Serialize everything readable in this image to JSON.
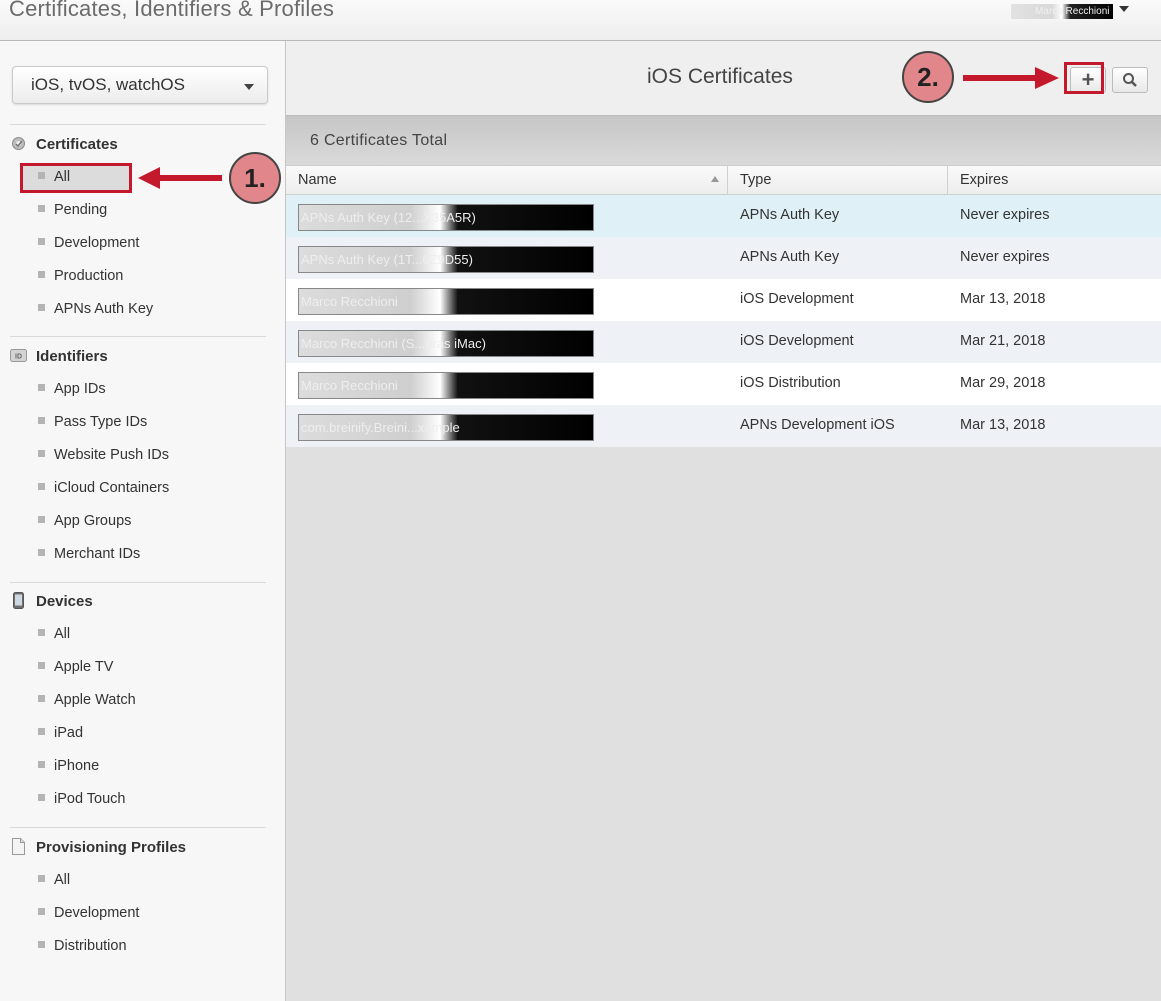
{
  "header": {
    "title": "Certificates, Identifiers & Profiles",
    "account_name": "Marco Recchioni"
  },
  "sidebar": {
    "platform_select": "iOS, tvOS, watchOS",
    "sections": [
      {
        "title": "Certificates",
        "icon": "certificate-gear-icon",
        "items": [
          "All",
          "Pending",
          "Development",
          "Production",
          "APNs Auth Key"
        ],
        "selected": "All"
      },
      {
        "title": "Identifiers",
        "icon": "id-badge-icon",
        "items": [
          "App IDs",
          "Pass Type IDs",
          "Website Push IDs",
          "iCloud Containers",
          "App Groups",
          "Merchant IDs"
        ]
      },
      {
        "title": "Devices",
        "icon": "iphone-device-icon",
        "items": [
          "All",
          "Apple TV",
          "Apple Watch",
          "iPad",
          "iPhone",
          "iPod Touch"
        ]
      },
      {
        "title": "Provisioning Profiles",
        "icon": "document-icon",
        "items": [
          "All",
          "Development",
          "Distribution"
        ]
      }
    ]
  },
  "main": {
    "title": "iOS Certificates",
    "add_label": "+",
    "total_label": "6 Certificates Total",
    "columns": [
      "Name",
      "Type",
      "Expires"
    ],
    "rows": [
      {
        "name": "APNs Auth Key (12...X35A5R)",
        "type": "APNs Auth Key",
        "expires": "Never expires"
      },
      {
        "name": "APNs Auth Key (1T...6Z9D55)",
        "type": "APNs Auth Key",
        "expires": "Never expires"
      },
      {
        "name": "Marco Recchioni",
        "type": "iOS Development",
        "expires": "Mar 13, 2018"
      },
      {
        "name": "Marco Recchioni (S...dras iMac)",
        "type": "iOS Development",
        "expires": "Mar 21, 2018"
      },
      {
        "name": "Marco Recchioni",
        "type": "iOS Distribution",
        "expires": "Mar 29, 2018"
      },
      {
        "name": "com.breinify.Breini...xample",
        "type": "APNs Development iOS",
        "expires": "Mar 13, 2018"
      }
    ]
  },
  "annotations": {
    "step1": "1.",
    "step2": "2."
  },
  "colors": {
    "annotation_red": "#c4182c",
    "step_circle": "#e1868a",
    "row_selected": "#dff0f7",
    "row_alt": "#eef2f7"
  }
}
